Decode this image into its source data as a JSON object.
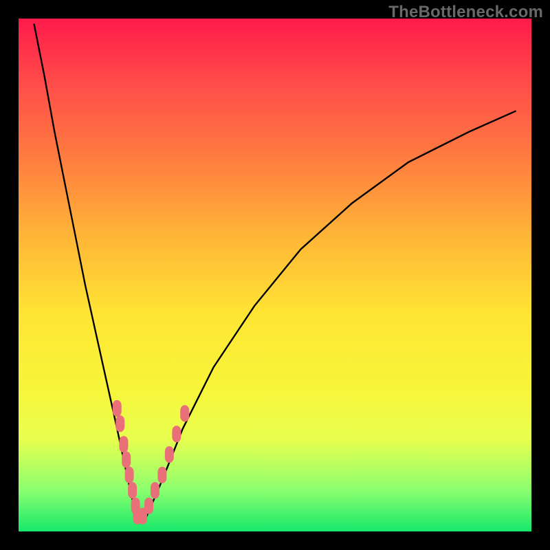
{
  "watermark": "TheBottleneck.com",
  "colors": {
    "background": "#000000",
    "gradient_top": "#ff1a4b",
    "gradient_bottom": "#15e86b",
    "curve": "#000000",
    "bead": "#e96f78"
  },
  "chart_data": {
    "type": "line",
    "title": "",
    "xlabel": "",
    "ylabel": "",
    "xlim": [
      0,
      100
    ],
    "ylim": [
      0,
      100
    ],
    "grid": false,
    "legend": false,
    "series": [
      {
        "name": "bottleneck-curve",
        "x": [
          3,
          5,
          7,
          9,
          11,
          13,
          15,
          17,
          19,
          20.5,
          22,
          23,
          24,
          25,
          28,
          32,
          38,
          46,
          55,
          65,
          76,
          88,
          97
        ],
        "y": [
          99,
          89,
          78,
          68,
          58,
          48,
          39,
          30,
          21,
          14,
          7,
          3,
          2,
          3,
          10,
          20,
          32,
          44,
          55,
          64,
          72,
          78,
          82
        ]
      }
    ],
    "vertex_x": 23.5,
    "bead_clusters": [
      {
        "name": "left-arm-beads",
        "points": [
          {
            "x": 19.2,
            "y": 24
          },
          {
            "x": 19.8,
            "y": 21
          },
          {
            "x": 20.5,
            "y": 17
          },
          {
            "x": 21.0,
            "y": 14
          },
          {
            "x": 21.6,
            "y": 11
          },
          {
            "x": 22.2,
            "y": 8
          },
          {
            "x": 22.8,
            "y": 5
          },
          {
            "x": 23.2,
            "y": 3
          }
        ]
      },
      {
        "name": "right-arm-beads",
        "points": [
          {
            "x": 24.2,
            "y": 3
          },
          {
            "x": 25.4,
            "y": 5
          },
          {
            "x": 26.6,
            "y": 8
          },
          {
            "x": 28.0,
            "y": 11
          },
          {
            "x": 29.4,
            "y": 15
          },
          {
            "x": 30.8,
            "y": 19
          },
          {
            "x": 32.4,
            "y": 23
          }
        ]
      }
    ]
  }
}
